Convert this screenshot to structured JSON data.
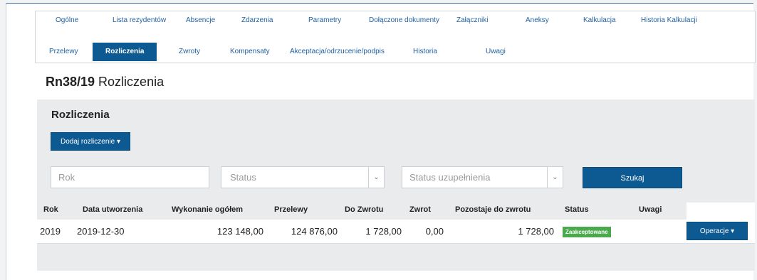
{
  "tabs": {
    "row1": [
      "Ogólne",
      "Lista rezydentów",
      "Absencje",
      "Zdarzenia",
      "Parametry",
      "Dołączone dokumenty",
      "Załączniki",
      "Aneksy",
      "Kalkulacja",
      "Historia Kalkulacji"
    ],
    "row2": [
      "Przelewy",
      "Rozliczenia",
      "Zwroty",
      "Kompensaty",
      "Akceptacja/odrzucenie/podpis",
      "Historia",
      "Uwagi"
    ],
    "active": "Rozliczenia"
  },
  "page": {
    "title_code": "Rn38/19",
    "title_rest": " Rozliczenia"
  },
  "panel": {
    "title": "Rozliczenia",
    "add_button": "Dodaj rozliczenie ▾",
    "search_button": "Szukaj",
    "rok_placeholder": "Rok",
    "status_placeholder": "Status",
    "status_uzup_placeholder": "Status uzupełnienia"
  },
  "table": {
    "headers": [
      "Rok",
      "Data utworzenia",
      "Wykonanie ogółem",
      "Przelewy",
      "Do Zwrotu",
      "Zwrot",
      "Pozostaje do zwrotu",
      "Status",
      "Uwagi"
    ],
    "rows": [
      {
        "rok": "2019",
        "data": "2019-12-30",
        "wykonanie": "123 148,00",
        "przelewy": "124 876,00",
        "do_zwrotu": "1 728,00",
        "zwrot": "0,00",
        "pozostaje": "1 728,00",
        "status": "Zaakceptowane",
        "uwagi": "",
        "ops_button": "Operacje ▾"
      }
    ]
  },
  "colors": {
    "primary": "#0d5a93",
    "success": "#4aa94c",
    "panel": "#e9ebed",
    "link": "#2161a2"
  },
  "icons": {
    "select_arrow": "chevron-down-icon"
  }
}
